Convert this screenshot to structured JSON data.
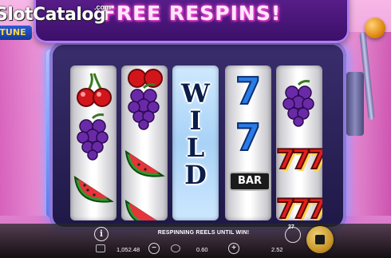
{
  "banner": {
    "text": "FREE RESPINS!"
  },
  "logo": {
    "text": "SlotCatalog",
    "suffix": ".com",
    "subtext": "TUNE"
  },
  "reels": {
    "wild_letters": [
      "W",
      "I",
      "L",
      "D"
    ],
    "bar_label": "BAR",
    "seven": "7",
    "sevens_red": "777"
  },
  "status_message": "RESPINNING REELS UNTIL WIN!",
  "balance": "1,052.48",
  "bet": "0.60",
  "win": "2.52",
  "autoplay_count": "27",
  "icons": {
    "info": "info-icon",
    "balance": "wallet-icon",
    "bet": "coin-stack-icon",
    "minus": "minus-icon",
    "plus": "plus-icon",
    "autoplay": "autoplay-icon",
    "spin": "stop-icon"
  },
  "colors": {
    "banner_text": "#ffe6ff",
    "banner_bg": "#5a1e8c",
    "spin_button": "#c9972a"
  }
}
